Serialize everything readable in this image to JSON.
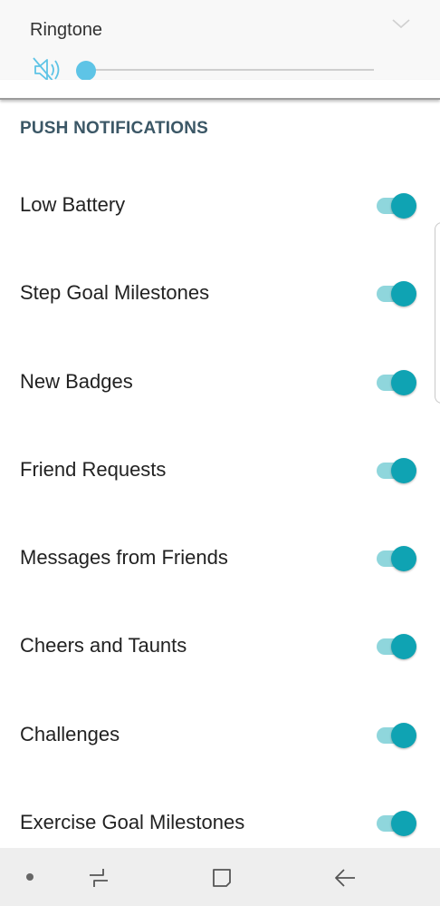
{
  "volume": {
    "label": "Ringtone",
    "level": 0,
    "muted": true,
    "icons": {
      "mute": "speaker-muted-icon",
      "expand": "chevron-down-icon"
    }
  },
  "section": {
    "title": "PUSH NOTIFICATIONS"
  },
  "notifications": [
    {
      "label": "Low Battery",
      "enabled": true
    },
    {
      "label": "Step Goal Milestones",
      "enabled": true
    },
    {
      "label": "New Badges",
      "enabled": true
    },
    {
      "label": "Friend Requests",
      "enabled": true
    },
    {
      "label": "Messages from Friends",
      "enabled": true
    },
    {
      "label": "Cheers and Taunts",
      "enabled": true
    },
    {
      "label": "Challenges",
      "enabled": true
    },
    {
      "label": "Exercise Goal Milestones",
      "enabled": true
    }
  ],
  "colors": {
    "accent": "#0fa3b3",
    "accent_light": "#8fd6dc",
    "slider": "#5ec4e6",
    "section_title": "#3b5766"
  },
  "nav": {
    "icons": [
      "nav-dot-icon",
      "recent-apps-icon",
      "home-icon",
      "back-icon"
    ]
  }
}
